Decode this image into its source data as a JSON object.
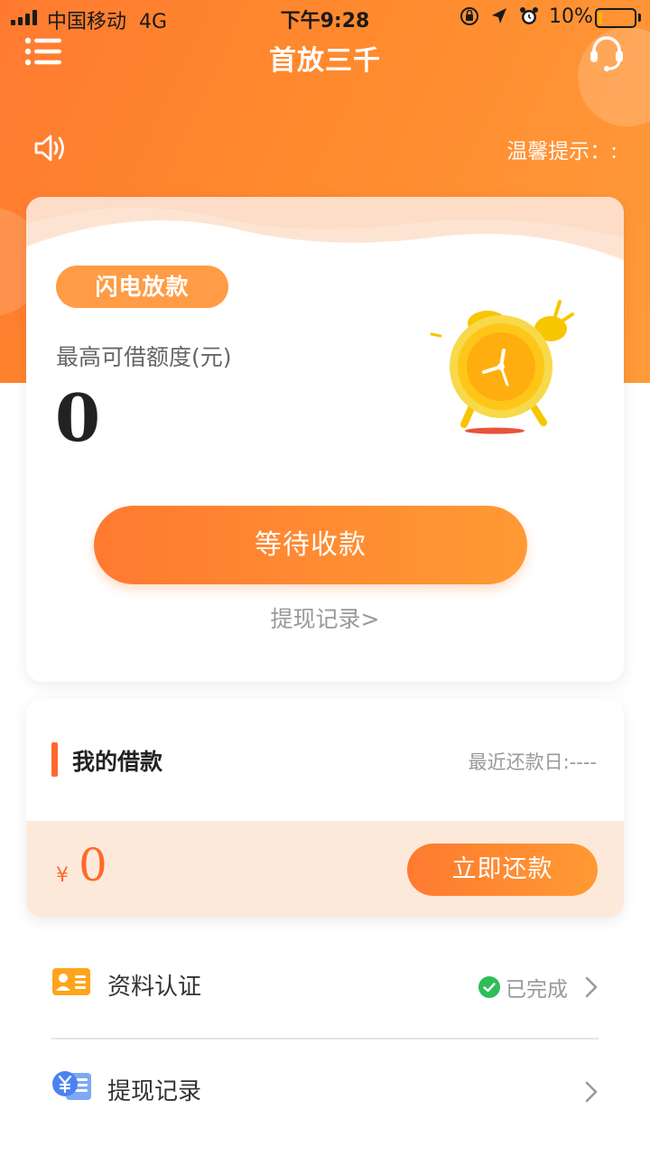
{
  "status_bar": {
    "carrier": "中国移动",
    "network": "4G",
    "time": "下午9:28",
    "battery_percent_text": "10%",
    "battery_level": 0.1
  },
  "nav": {
    "title": "首放三千",
    "menu_icon": "menu-icon",
    "service_icon": "headset-icon"
  },
  "notice": {
    "speaker_icon": "speaker-icon",
    "tip_text": "温馨提示：:"
  },
  "loan_card": {
    "badge": "闪电放款",
    "limit_label": "最高可借额度(元)",
    "limit_value": "0",
    "clock_icon": "alarm-clock-icon",
    "wait_button": "等待收款",
    "withdraw_link": "提现记录>"
  },
  "my_loan": {
    "title": "我的借款",
    "recent_due": "最近还款日:----",
    "currency": "¥",
    "amount": "0",
    "repay_button": "立即还款"
  },
  "list": [
    {
      "icon": "id-card-icon",
      "label": "资料认证",
      "status": "已完成",
      "status_icon": "check-circle-icon"
    },
    {
      "icon": "yuan-record-icon",
      "label": "提现记录"
    }
  ],
  "colors": {
    "primary": "#ff7a30",
    "accent_end": "#ff9a33",
    "success": "#2ebd59",
    "loan_footer_bg": "#fde9da"
  }
}
